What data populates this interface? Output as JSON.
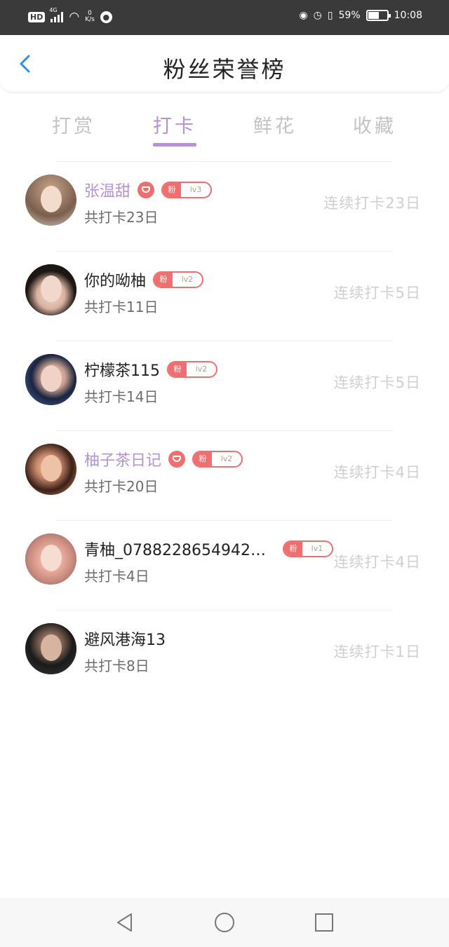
{
  "status_bar": {
    "hd": "HD",
    "network": "4G",
    "speed_value": "0",
    "speed_unit": "K/s",
    "battery": "59%",
    "battery_level": 0.59,
    "time": "10:08"
  },
  "header": {
    "title": "粉丝荣誉榜"
  },
  "tabs": [
    {
      "label": "打赏",
      "active": false
    },
    {
      "label": "打卡",
      "active": true
    },
    {
      "label": "鲜花",
      "active": false
    },
    {
      "label": "收藏",
      "active": false
    }
  ],
  "fans": [
    {
      "name": "张温甜",
      "vip": true,
      "has_gem": true,
      "badge_fan": "粉",
      "badge_level": "lv3",
      "total": "共打卡23日",
      "streak": "连续打卡23日"
    },
    {
      "name": "你的呦柚",
      "vip": false,
      "has_gem": false,
      "badge_fan": "粉",
      "badge_level": "lv2",
      "total": "共打卡11日",
      "streak": "连续打卡5日"
    },
    {
      "name": "柠檬茶115",
      "vip": false,
      "has_gem": false,
      "badge_fan": "粉",
      "badge_level": "lv2",
      "total": "共打卡14日",
      "streak": "连续打卡5日"
    },
    {
      "name": "柚子茶日记",
      "vip": true,
      "has_gem": true,
      "badge_fan": "粉",
      "badge_level": "lv2",
      "total": "共打卡20日",
      "streak": "连续打卡4日"
    },
    {
      "name": "青柚_0788228654942…",
      "vip": false,
      "has_gem": false,
      "badge_fan": "粉",
      "badge_level": "lv1",
      "total": "共打卡4日",
      "streak": "连续打卡4日"
    },
    {
      "name": "避风港海13",
      "vip": false,
      "has_gem": false,
      "badge_fan": null,
      "badge_level": null,
      "total": "共打卡8日",
      "streak": "连续打卡1日"
    }
  ],
  "colors": {
    "accent": "#b592d2",
    "badge": "#ef6e70",
    "back_arrow": "#2f8ee0",
    "muted": "#cfcfcf"
  },
  "icons": {
    "back": "chevron-left-icon",
    "gem": "diamond-icon",
    "nav_back": "triangle-back-icon",
    "nav_home": "circle-home-icon",
    "nav_recent": "square-recent-icon"
  }
}
